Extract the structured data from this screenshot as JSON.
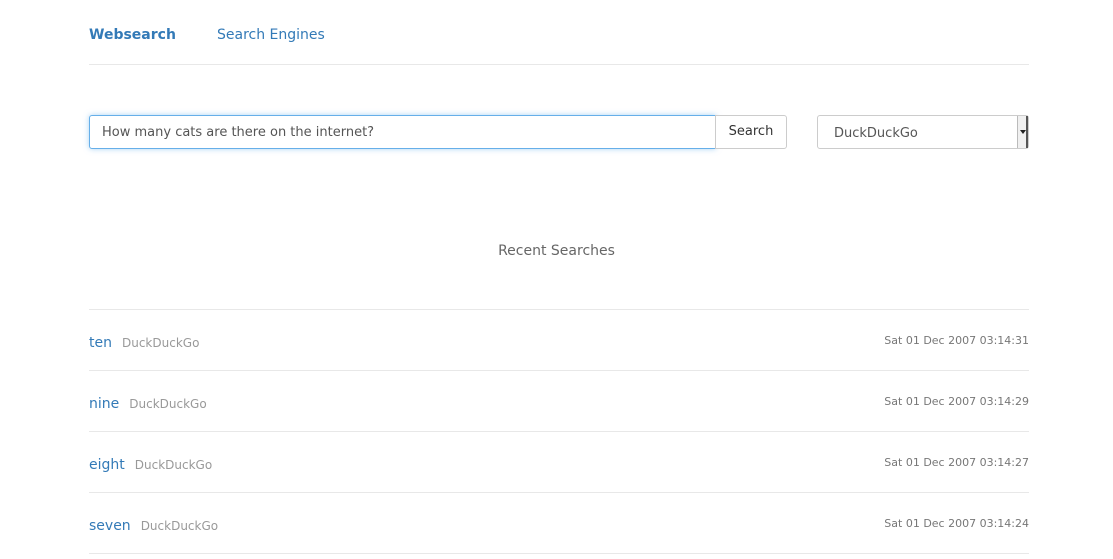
{
  "nav": {
    "brand": "Websearch",
    "engines_link": "Search Engines"
  },
  "search": {
    "query": "How many cats are there on the internet?",
    "button_label": "Search",
    "selected_engine": "DuckDuckGo"
  },
  "recent": {
    "title": "Recent Searches",
    "items": [
      {
        "query": "ten",
        "engine": "DuckDuckGo",
        "time": "Sat 01 Dec 2007 03:14:31"
      },
      {
        "query": "nine",
        "engine": "DuckDuckGo",
        "time": "Sat 01 Dec 2007 03:14:29"
      },
      {
        "query": "eight",
        "engine": "DuckDuckGo",
        "time": "Sat 01 Dec 2007 03:14:27"
      },
      {
        "query": "seven",
        "engine": "DuckDuckGo",
        "time": "Sat 01 Dec 2007 03:14:24"
      }
    ]
  },
  "colors": {
    "link": "#337ab7",
    "focus_border": "#66afe9",
    "muted": "#999999"
  }
}
